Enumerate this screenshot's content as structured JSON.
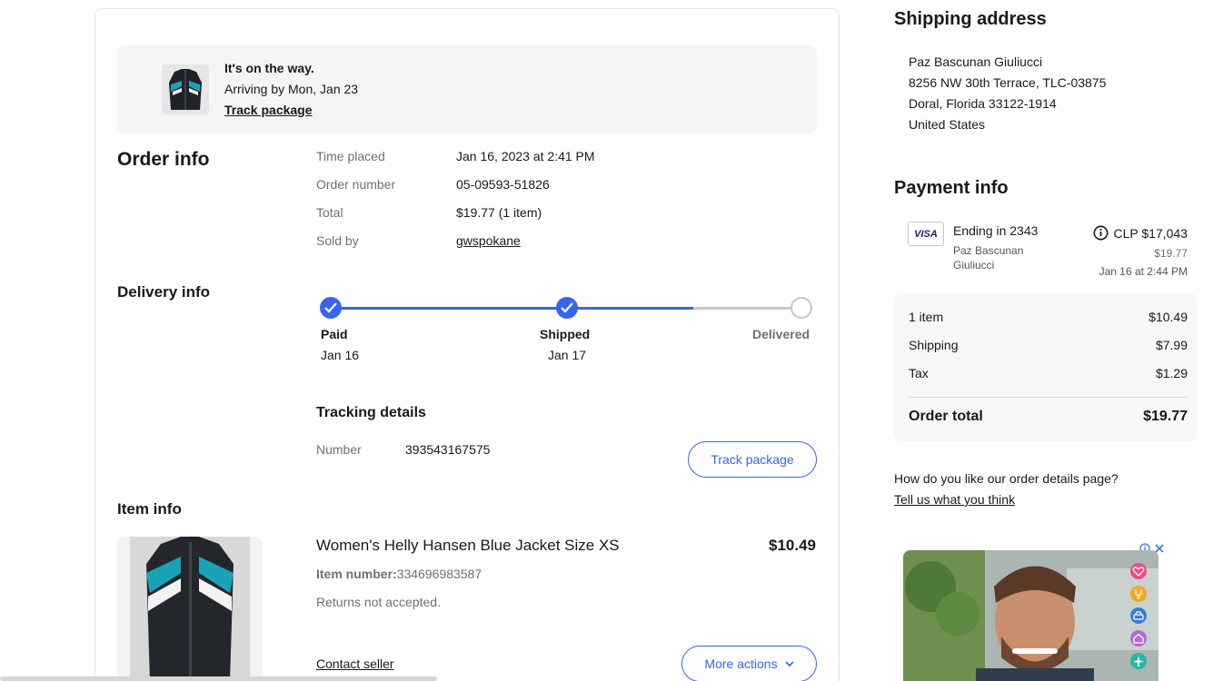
{
  "banner": {
    "status": "It's on the way.",
    "arriving": "Arriving by Mon, Jan 23",
    "track_link": "Track package"
  },
  "order_info": {
    "title": "Order info",
    "rows": [
      {
        "label": "Time placed",
        "value": "Jan 16, 2023 at 2:41 PM"
      },
      {
        "label": "Order number",
        "value": "05-09593-51826"
      },
      {
        "label": "Total",
        "value": "$19.77 (1 item)"
      },
      {
        "label": "Sold by",
        "value": "gwspokane"
      }
    ]
  },
  "delivery_info": {
    "title": "Delivery info",
    "progress_fraction": 0.77,
    "steps": [
      {
        "label": "Paid",
        "date": "Jan 16",
        "done": true
      },
      {
        "label": "Shipped",
        "date": "Jan 17",
        "done": true
      },
      {
        "label": "Delivered",
        "date": "",
        "done": false
      }
    ],
    "tracking_title": "Tracking details",
    "number_label": "Number",
    "number_value": "393543167575",
    "track_button": "Track package"
  },
  "item_info": {
    "title": "Item info",
    "name": "Women's Helly Hansen Blue Jacket Size XS",
    "price": "$10.49",
    "item_number_label": "Item number:",
    "item_number": "334696983587",
    "returns": "Returns not accepted.",
    "contact_seller": "Contact seller",
    "more_actions": "More actions"
  },
  "shipping_address": {
    "title": "Shipping address",
    "lines": [
      "Paz Bascunan Giuliucci",
      "8256 NW 30th Terrace, TLC-03875",
      "Doral, Florida 33122-1914",
      "United States"
    ]
  },
  "payment_info": {
    "title": "Payment info",
    "card_brand": "VISA",
    "card_ending": "Ending in 2343",
    "card_holder_line1": "Paz Bascunan",
    "card_holder_line2": "Giuliucci",
    "amount_local": "CLP $17,043",
    "amount_usd": "$19.77",
    "charged_at": "Jan 16 at 2:44 PM"
  },
  "summary": {
    "rows": [
      {
        "label": "1 item",
        "value": "$10.49"
      },
      {
        "label": "Shipping",
        "value": "$7.99"
      },
      {
        "label": "Tax",
        "value": "$1.29"
      }
    ],
    "total_label": "Order total",
    "total_value": "$19.77"
  },
  "feedback": {
    "question": "How do you like our order details page?",
    "link": "Tell us what you think"
  },
  "ad": {
    "icons": [
      "heart-icon",
      "stethoscope-icon",
      "car-icon",
      "home-icon",
      "plane-icon"
    ],
    "icon_colors": [
      "#e84b8a",
      "#f5a623",
      "#3a7bd5",
      "#b06ad9",
      "#2bb3a6"
    ]
  },
  "colors": {
    "accent": "#3665f3",
    "inactive": "#c7c7c7"
  }
}
